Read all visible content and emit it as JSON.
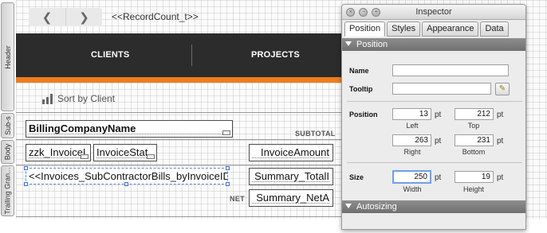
{
  "layout": {
    "parts": {
      "header": "Header",
      "subsummary": "Sub-s",
      "body": "Body",
      "trailing_grand": "Trailing Gran..."
    },
    "nav": {
      "back_icon": "chevron-left-icon",
      "forward_icon": "chevron-right-icon",
      "back_glyph": "❮",
      "forward_glyph": "❯",
      "record_count": "<<RecordCount_t>>"
    },
    "menu": {
      "clients": "CLIENTS",
      "projects": "PROJECTS"
    },
    "sort": {
      "icon": "bar-chart-icon",
      "label": "Sort by Client"
    },
    "fields": {
      "billing_company": "BillingCompanyName",
      "subtotal": "SUBTOTAL",
      "invoice_id": "zzk_InvoiceI",
      "invoice_status": "InvoiceStat",
      "invoice_amount": "InvoiceAmount",
      "portal_field": "<<Invoices_SubContractorBills_byInvoiceID::",
      "summary_total": "Summary_TotalI",
      "net": "NET",
      "summary_net": "Summary_NetA"
    },
    "colors": {
      "nav_bar": "#2c2c2c",
      "accent": "#ee7d20"
    }
  },
  "inspector": {
    "title": "Inspector",
    "window_buttons": {
      "close": "×",
      "minimize": "−",
      "zoom": "+"
    },
    "tabs": [
      "Position",
      "Styles",
      "Appearance",
      "Data"
    ],
    "active_tab": "Position",
    "section_position": "Position",
    "section_autosizing": "Autosizing",
    "name_label": "Name",
    "name_value": "",
    "tooltip_label": "Tooltip",
    "tooltip_value": "",
    "tooltip_button_glyph": "✎",
    "position_label": "Position",
    "left": "13",
    "top": "212",
    "right": "263",
    "bottom": "231",
    "left_label": "Left",
    "top_label": "Top",
    "right_label": "Right",
    "bottom_label": "Bottom",
    "size_label": "Size",
    "width": "250",
    "height": "19",
    "width_label": "Width",
    "height_label": "Height",
    "unit": "pt"
  }
}
